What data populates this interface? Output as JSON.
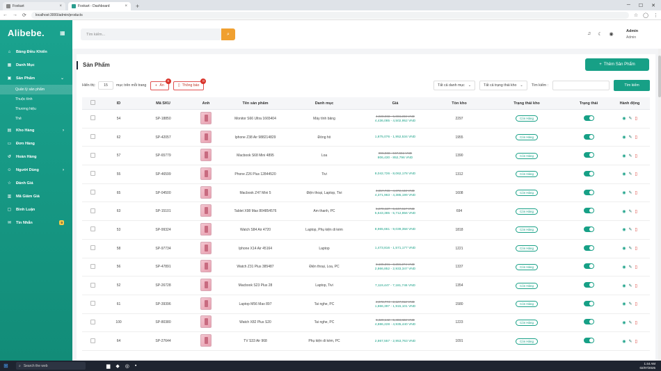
{
  "browser": {
    "tabs": [
      {
        "title": "Foxkart",
        "active": false
      },
      {
        "title": "Foxkart - Dashboard",
        "active": true
      }
    ],
    "url": "localhost:3000/admin/products"
  },
  "sidebar": {
    "brand": "Alibebe.",
    "items": [
      {
        "label": "Bảng Điều Khiển",
        "icon": "home-icon"
      },
      {
        "label": "Danh Mục",
        "icon": "grid-icon"
      },
      {
        "label": "Sản Phẩm",
        "icon": "box-icon",
        "expanded": true
      },
      {
        "label": "Kho Hàng",
        "icon": "warehouse-icon"
      },
      {
        "label": "Đơn Hàng",
        "icon": "cart-icon"
      },
      {
        "label": "Hoàn Hàng",
        "icon": "return-icon"
      },
      {
        "label": "Người Dùng",
        "icon": "users-icon"
      },
      {
        "label": "Đánh Giá",
        "icon": "star-icon"
      },
      {
        "label": "Mã Giảm Giá",
        "icon": "ticket-icon"
      },
      {
        "label": "Bình Luận",
        "icon": "comment-icon"
      },
      {
        "label": "Tin Nhắn",
        "icon": "message-icon",
        "badge": "0"
      }
    ],
    "subitems": [
      {
        "label": "Quản lý sản phẩm",
        "active": true
      },
      {
        "label": "Thuộc tính"
      },
      {
        "label": "Thương hiệu"
      },
      {
        "label": "Thẻ"
      }
    ]
  },
  "header": {
    "search_placeholder": "Tìm kiếm...",
    "user_name": "Admin",
    "user_role": "Admin"
  },
  "main": {
    "title": "Sản Phẩm",
    "add_label": "Thêm Sản Phẩm",
    "show_label": "Hiển thị:",
    "page_size": "15",
    "per_page_label": "mục trên mỗi trang",
    "hidden_label": "Ẩn",
    "hidden_count": "0",
    "notify_label": "Thông báo",
    "notify_count": "0",
    "category_filter": "Tất cả danh mục",
    "stock_filter": "Tất cả trạng thái kho",
    "search_label": "Tìm kiếm :",
    "search_btn": "Tìm kiếm"
  },
  "table": {
    "headers": [
      "ID",
      "Mã SKU",
      "Ảnh",
      "Tên sản phẩm",
      "Danh mục",
      "Giá",
      "Tồn kho",
      "Trạng thái kho",
      "Trạng thái",
      "Hành động"
    ],
    "rows": [
      {
        "id": "54",
        "sku": "SP-18850",
        "name": "Monitor S66 Ultra 1665404",
        "cat": "Máy tính bảng",
        "old": "4,928,983 - 5,003,283 VND",
        "new": "4,436,085 - 4,502,952 VND",
        "stock": "2297",
        "status": "Còn Hàng"
      },
      {
        "id": "62",
        "sku": "SP-42057",
        "name": "Iphone Z38 Air 988214829",
        "cat": "Đồng hồ",
        "old": "",
        "new": "1,875,076 - 1,952,534 VND",
        "stock": "1955",
        "status": "Còn Hàng"
      },
      {
        "id": "57",
        "sku": "SP-65779",
        "name": "Macbook S68 Mini 4895",
        "cat": "Loa",
        "old": "896,033 - 947,551 VND",
        "new": "806,430 - 852,796 VND",
        "stock": "1390",
        "status": "Còn Hàng"
      },
      {
        "id": "55",
        "sku": "SP-46599",
        "name": "Phone Z26 Plus 12844520",
        "cat": "Tivi",
        "old": "",
        "new": "8,042,726 - 8,062,178 VND",
        "stock": "1312",
        "status": "Còn Hàng"
      },
      {
        "id": "65",
        "sku": "SP-04500",
        "name": "Macbook Z47 Mini 5",
        "cat": "Điện thoại, Laptop, Tivi",
        "old": "4,857,736 - 4,872,443 VND",
        "new": "4,371,963 - 4,385,199 VND",
        "stock": "1608",
        "status": "Còn Hàng"
      },
      {
        "id": "63",
        "sku": "SP-15101",
        "name": "Tablet X98 Max 804854576",
        "cat": "Âm thanh, PC",
        "old": "5,270,427 - 5,347,617 VND",
        "new": "5,643,385 - 5,712,856 VND",
        "stock": "694",
        "status": "Còn Hàng"
      },
      {
        "id": "53",
        "sku": "SP-99324",
        "name": "Watch S84 Air 4720",
        "cat": "Laptop, Phụ kiện di kèm",
        "old": "",
        "new": "8,965,661 - 9,039,358 VND",
        "stock": "1818",
        "status": "Còn Hàng"
      },
      {
        "id": "58",
        "sku": "SP-97734",
        "name": "Iphone X14 Air 45164",
        "cat": "Laptop",
        "old": "",
        "new": "1,473,816 - 1,571,177 VND",
        "stock": "1221",
        "status": "Còn Hàng"
      },
      {
        "id": "56",
        "sku": "SP-47891",
        "name": "Watch Z31 Plus 385487",
        "cat": "Điện thoại, Loa, PC",
        "old": "3,185,391 - 3,259,274 VND",
        "new": "2,866,852 - 2,933,347 VND",
        "stock": "1337",
        "status": "Còn Hàng"
      },
      {
        "id": "52",
        "sku": "SP-26728",
        "name": "Macbook S23 Plus 28",
        "cat": "Laptop, Tivi",
        "old": "",
        "new": "7,119,447 - 7,181,746 VND",
        "stock": "1354",
        "status": "Còn Hàng"
      },
      {
        "id": "61",
        "sku": "SP-39396",
        "name": "Laptop M56 Max 897",
        "cat": "Tai nghe, PC",
        "old": "2,073,774 - 2,127,012 VND",
        "new": "1,866,397 - 1,915,101 VND",
        "stock": "1580",
        "status": "Còn Hàng"
      },
      {
        "id": "100",
        "sku": "SP-80380",
        "name": "Watch X82 Plus S20",
        "cat": "Tai nghe, PC",
        "old": "5,429,142 - 5,483,822 VND",
        "new": "4,886,228 - 4,935,440 VND",
        "stock": "1223",
        "status": "Còn Hàng"
      },
      {
        "id": "64",
        "sku": "SP-27644",
        "name": "TV S33 Air 968",
        "cat": "Phụ kiện di kèm, PC",
        "old": "",
        "new": "2,867,557 - 2,953,763 VND",
        "stock": "1091",
        "status": "Còn Hàng"
      }
    ]
  },
  "taskbar": {
    "search_placeholder": "Search the web",
    "time": "1:44 AM",
    "date": "02/07/2025"
  },
  "colors": {
    "brand": "#17a086",
    "danger": "#d9342b",
    "accent": "#f0a030"
  }
}
